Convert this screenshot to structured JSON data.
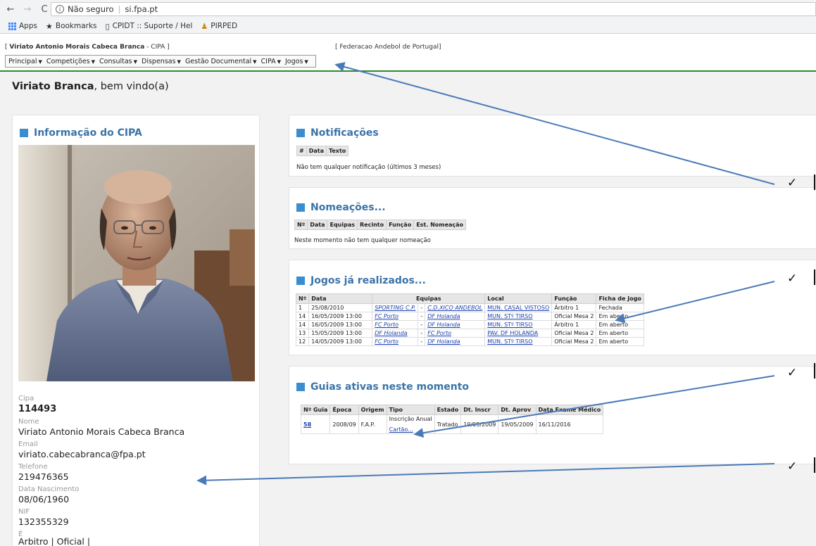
{
  "browser": {
    "security_label": "Não seguro",
    "url": "si.fpa.pt",
    "bookmarks": [
      {
        "label": "Apps",
        "icon": "apps-grid-icon"
      },
      {
        "label": "Bookmarks",
        "icon": "star-icon"
      },
      {
        "label": "CPIDT :: Suporte / Hel",
        "icon": "page-icon"
      },
      {
        "label": "PIRPED",
        "icon": "people-icon"
      }
    ]
  },
  "site": {
    "user_prefix": "[ ",
    "user_name": "Viriato Antonio Morais Cabeca Branca",
    "user_suffix": " - CIPA ]",
    "federation": "[ Federacao Andebol de Portugal]",
    "menu": [
      "Principal",
      "Competições",
      "Consultas",
      "Dispensas",
      "Gestão Documental",
      "CIPA",
      "Jogos"
    ],
    "welcome_name": "Viriato Branca",
    "welcome_rest": ", bem vindo(a)"
  },
  "cipa_info": {
    "title": "Informação do CIPA",
    "fields": [
      {
        "label": "Cipa",
        "value": "114493"
      },
      {
        "label": "Nome",
        "value": "Viriato Antonio Morais Cabeca Branca"
      },
      {
        "label": "Email",
        "value": "viriato.cabecabranca@fpa.pt"
      },
      {
        "label": "Telefone",
        "value": "219476365"
      },
      {
        "label": "Data Nascimento",
        "value": "08/06/1960"
      },
      {
        "label": "NIF",
        "value": "132355329"
      },
      {
        "label": "É",
        "value": "Arbitro | Oficial |"
      }
    ]
  },
  "notificacoes": {
    "title": "Notificações",
    "headers": [
      "#",
      "Data",
      "Texto"
    ],
    "empty_msg": "Não tem qualquer notificação (últimos 3 meses)"
  },
  "nomeacoes": {
    "title": "Nomeações...",
    "headers": [
      "Nº",
      "Data",
      "Equipas",
      "Recinto",
      "Função",
      "Est. Nomeação"
    ],
    "empty_msg": "Neste momento não tem qualquer nomeação"
  },
  "jogos": {
    "title": "Jogos já realizados...",
    "headers": [
      "Nº",
      "Data",
      "Equipas",
      "Local",
      "Função",
      "Ficha de Jogo"
    ],
    "rows": [
      {
        "n": "1",
        "data": "25/08/2010",
        "home": "SPORTING C.P.",
        "away": "C.D.XICO ANDEBOL",
        "local": "MUN. CASAL VISTOSO",
        "funcao": "Árbitro 1",
        "ficha": "Fechada"
      },
      {
        "n": "14",
        "data": "16/05/2009 13:00",
        "home": "FC Porto",
        "away": "DF Holanda",
        "local": "MUN. STº TIRSO",
        "funcao": "Oficial Mesa 2",
        "ficha": "Em aberto"
      },
      {
        "n": "14",
        "data": "16/05/2009 13:00",
        "home": "FC Porto",
        "away": "DF Holanda",
        "local": "MUN. STº TIRSO",
        "funcao": "Árbitro 1",
        "ficha": "Em aberto"
      },
      {
        "n": "13",
        "data": "15/05/2009 13:00",
        "home": "DF Holanda",
        "away": "FC Porto",
        "local": "PAV. DF HOLANDA",
        "funcao": "Oficial Mesa 2",
        "ficha": "Em aberto"
      },
      {
        "n": "12",
        "data": "14/05/2009 13:00",
        "home": "FC Porto",
        "away": "DF Holanda",
        "local": "MUN. STº TIRSO",
        "funcao": "Oficial Mesa 2",
        "ficha": "Em aberto"
      }
    ]
  },
  "guias": {
    "title": "Guias ativas neste momento",
    "headers": [
      "Nº Guia",
      "Época",
      "Origem",
      "Tipo",
      "Estado",
      "Dt. Inscr",
      "Dt. Aprov",
      "Data Exame Médico"
    ],
    "row": {
      "n": "58",
      "epoca": "2008/09",
      "origem": "F.A.P.",
      "tipo": "Inscrição Anual",
      "tipo_link": "Cartão...",
      "estado": "Tratado",
      "dt_inscr": "19/05/2009",
      "dt_aprov": "19/05/2009",
      "exame": "16/11/2016"
    }
  },
  "annotations": {
    "check": "✓"
  },
  "colors": {
    "accent": "#3a8ed0",
    "title": "#3a74a8",
    "link": "#1a3fae",
    "header_rule": "#2e8b2e",
    "arrow": "#4a7ab8"
  }
}
